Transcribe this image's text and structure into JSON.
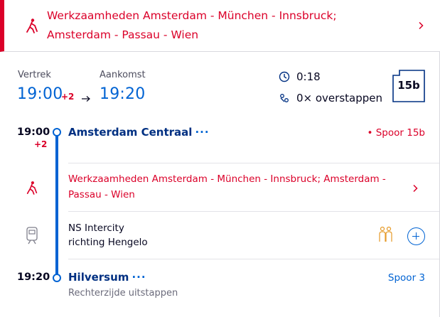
{
  "alert": {
    "text": "Werkzaamheden Amsterdam - München - Innsbruck; Amsterdam - Passau - Wien",
    "icon": "worker-icon",
    "color": "#db0029"
  },
  "summary": {
    "departure_label": "Vertrek",
    "departure_time": "19:00",
    "departure_delay": "+2",
    "arrival_label": "Aankomst",
    "arrival_time": "19:20",
    "duration": "0:18",
    "transfers": "0× overstappen",
    "platform": "15b"
  },
  "stops": [
    {
      "time": "19:00",
      "delay": "+2",
      "name": "Amsterdam Centraal",
      "more": "···",
      "platform": "• Spoor 15b",
      "platform_color": "#db0029"
    },
    {
      "time": "19:20",
      "delay": "",
      "name": "Hilversum",
      "more": "···",
      "platform": "Spoor 3",
      "platform_color": "#0063d3",
      "note": "Rechterzijde uitstappen"
    }
  ],
  "disruption": {
    "text": "Werkzaamheden Amsterdam - München - Innsbruck; Amsterdam - Passau - Wien"
  },
  "train": {
    "line1": "NS Intercity",
    "line2": "richting Hengelo",
    "icons": [
      "train-icon",
      "crowd-icon",
      "add-icon"
    ]
  },
  "colors": {
    "accent": "#0063d3",
    "alert": "#db0029",
    "station": "#003082",
    "crowd": "#e69a28"
  }
}
